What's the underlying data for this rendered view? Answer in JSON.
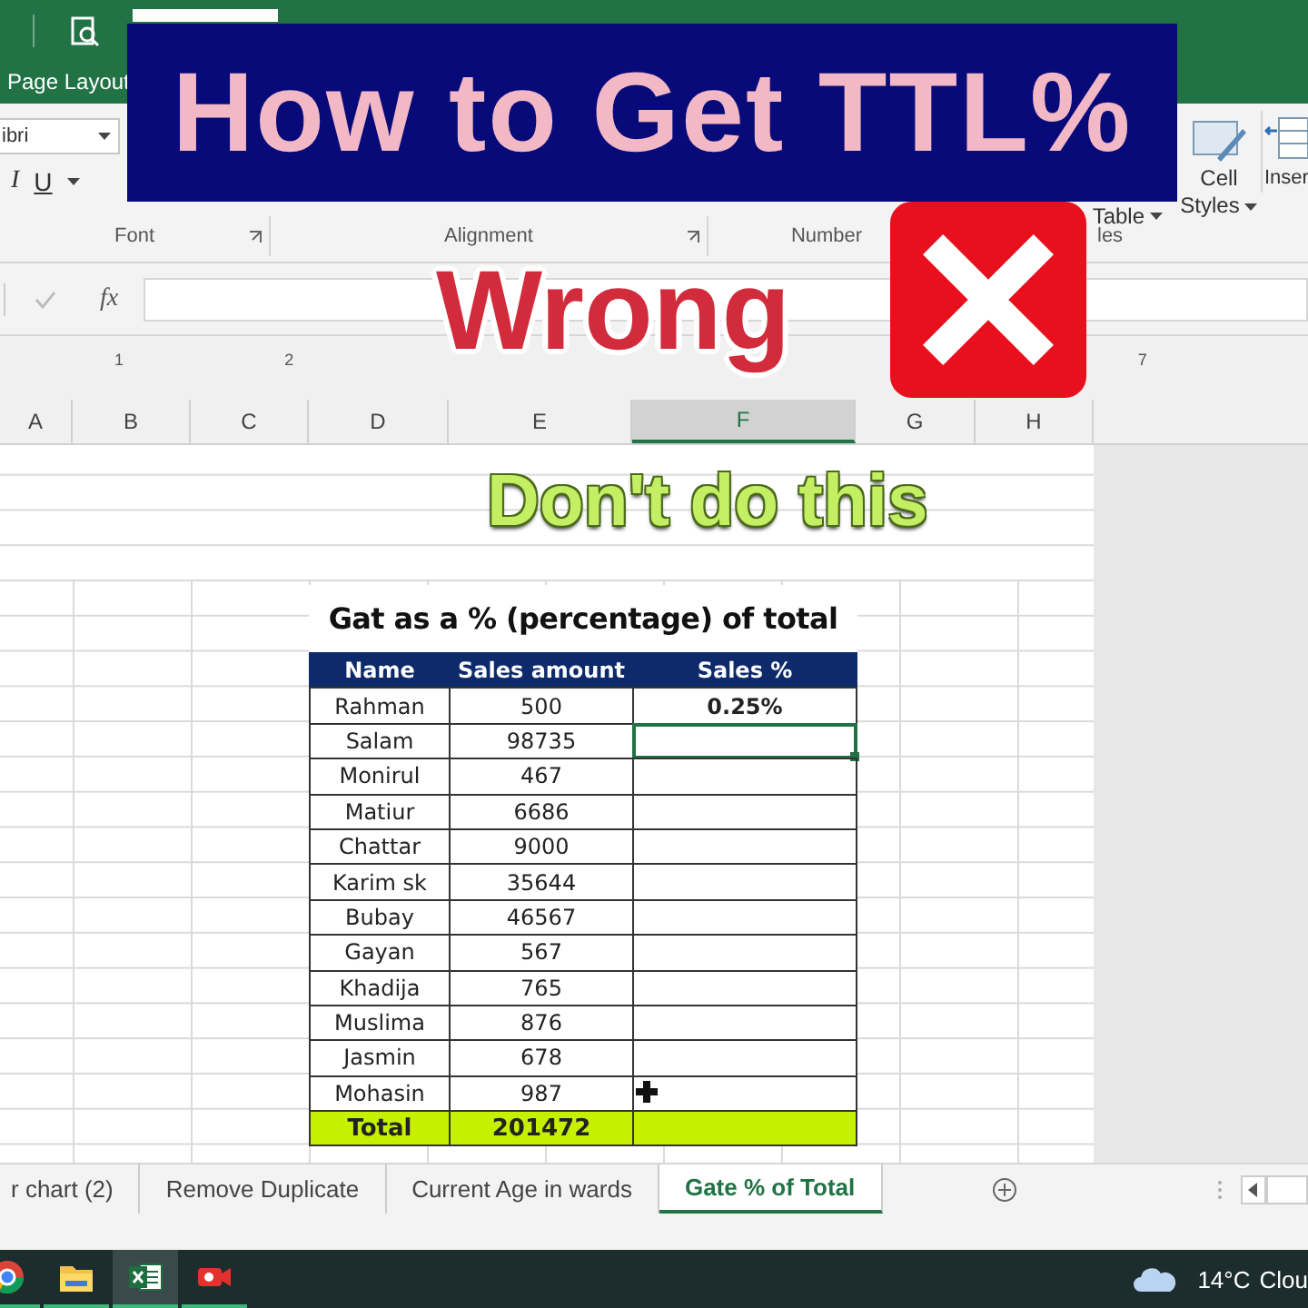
{
  "ribbon": {
    "tab": "Page Layout",
    "font_box": "ibri",
    "format_keys": [
      "I",
      "U"
    ],
    "table_label": "Table",
    "cell_styles": [
      "Cell",
      "Styles"
    ],
    "insert": "Inser",
    "groups": [
      {
        "label": "Font"
      },
      {
        "label": "Alignment"
      },
      {
        "label": "Number"
      },
      {
        "label": "les"
      }
    ]
  },
  "formula_bar": {
    "fx": "fx"
  },
  "ruler": [
    {
      "label": "1",
      "kind": "near"
    },
    {
      "label": "2",
      "kind": "near"
    },
    {
      "label": "7",
      "kind": "far"
    }
  ],
  "columns": [
    {
      "label": "A",
      "selected": false
    },
    {
      "label": "B",
      "selected": false
    },
    {
      "label": "C",
      "selected": false
    },
    {
      "label": "D",
      "selected": false
    },
    {
      "label": "E",
      "selected": false
    },
    {
      "label": "F",
      "selected": true
    },
    {
      "label": "G",
      "selected": false
    },
    {
      "label": "H",
      "selected": false
    }
  ],
  "table": {
    "title": "Gat as a % (percentage) of total",
    "columns": [
      "Name",
      "Sales amount",
      "Sales %"
    ],
    "rows": [
      {
        "name": "Rahman",
        "amount": "500",
        "percent": "0.25%",
        "selected": false
      },
      {
        "name": "Salam",
        "amount": "98735",
        "selected": true
      },
      {
        "name": "Monirul",
        "amount": "467",
        "selected": false
      },
      {
        "name": "Matiur",
        "amount": "6686",
        "selected": false
      },
      {
        "name": "Chattar",
        "amount": "9000",
        "selected": false
      },
      {
        "name": "Karim sk",
        "amount": "35644",
        "selected": false
      },
      {
        "name": "Bubay",
        "amount": "46567",
        "selected": false
      },
      {
        "name": "Gayan",
        "amount": "567",
        "selected": false
      },
      {
        "name": "Khadija",
        "amount": "765",
        "selected": false
      },
      {
        "name": "Muslima",
        "amount": "876",
        "selected": false
      },
      {
        "name": "Jasmin",
        "amount": "678",
        "selected": false
      },
      {
        "name": "Mohasin",
        "amount": "987",
        "selected": false
      }
    ],
    "total": {
      "label": "Total",
      "amount": "201472"
    }
  },
  "sheet_tabs": [
    {
      "label": "r chart (2)",
      "selected": false
    },
    {
      "label": "Remove Duplicate",
      "selected": false
    },
    {
      "label": "Current Age in wards",
      "selected": false
    },
    {
      "label": "Gate % of Total",
      "selected": true
    }
  ],
  "taskbar": {
    "apps": [
      {
        "kind": "browser",
        "active": false
      },
      {
        "kind": "folder",
        "active": false
      },
      {
        "kind": "excel",
        "active": true
      },
      {
        "kind": "recorder",
        "active": false
      }
    ],
    "temperature": "14°C",
    "weather": "Clou"
  },
  "overlay": {
    "headline": "How to Get TTL%",
    "verdict": "Wrong",
    "note": "Don't do this"
  }
}
